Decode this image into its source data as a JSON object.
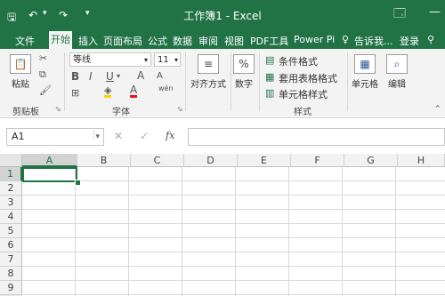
{
  "window": {
    "title": "工作簿1 - Excel"
  },
  "tabs": [
    "文件",
    "开始",
    "插入",
    "页面布局",
    "公式",
    "数据",
    "审阅",
    "视图",
    "PDF工具",
    "Power Pi"
  ],
  "active_tab": "开始",
  "tell_me": "告诉我...",
  "login": "登录",
  "ribbon": {
    "clipboard": {
      "paste": "粘贴",
      "label": "剪贴板"
    },
    "font": {
      "name": "等线",
      "size": "11",
      "label": "字体",
      "bold": "B",
      "italic": "I",
      "underline": "U",
      "grow": "A",
      "shrink": "A",
      "color_letter": "A",
      "wen": "wén"
    },
    "align": {
      "label": "对齐方式"
    },
    "number": {
      "label": "数字",
      "icon": "%"
    },
    "styles": {
      "conditional": "条件格式",
      "table": "套用表格格式",
      "cell_styles": "单元格样式",
      "label": "样式"
    },
    "cells": {
      "label": "单元格"
    },
    "edit": {
      "label": "编辑"
    }
  },
  "formula": {
    "namebox": "A1",
    "fx": "fx",
    "cancel": "✕",
    "confirm": "✓",
    "value": ""
  },
  "sheet": {
    "columns": [
      "A",
      "B",
      "C",
      "D",
      "E",
      "F",
      "G",
      "H"
    ],
    "rows": [
      "1",
      "2",
      "3",
      "4",
      "5",
      "6",
      "7",
      "8",
      "9"
    ],
    "selected_cell": "A1"
  },
  "colors": {
    "accent": "#217346",
    "font_color": "#e81123",
    "highlight": "#ffd500"
  }
}
